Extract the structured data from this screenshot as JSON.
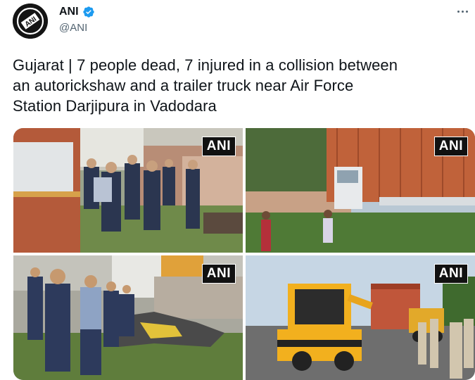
{
  "author": {
    "display_name": "ANI",
    "handle": "@ANI",
    "avatar_logo_text": "ANI",
    "avatar_icon": "ani-logo",
    "verified_icon": "verified-badge-icon",
    "more_icon": "more-options-icon"
  },
  "tweet": {
    "text_line1": "Gujarat | 7 people dead, 7 injured in a collision between",
    "text_line2": "an autorickshaw and a trailer truck near Air Force",
    "text_line3": "Station Darjipura in Vadodara"
  },
  "media": {
    "photos": [
      {
        "watermark": "ANI",
        "alt": "photo-1"
      },
      {
        "watermark": "ANI",
        "alt": "photo-2"
      },
      {
        "watermark": "ANI",
        "alt": "photo-3"
      },
      {
        "watermark": "ANI",
        "alt": "photo-4"
      }
    ]
  },
  "colors": {
    "text_primary": "#0f1419",
    "text_secondary": "#536471",
    "verified_blue": "#1d9bf0",
    "trailer_orange": "#c0623a",
    "crane_yellow": "#f2b01e"
  }
}
